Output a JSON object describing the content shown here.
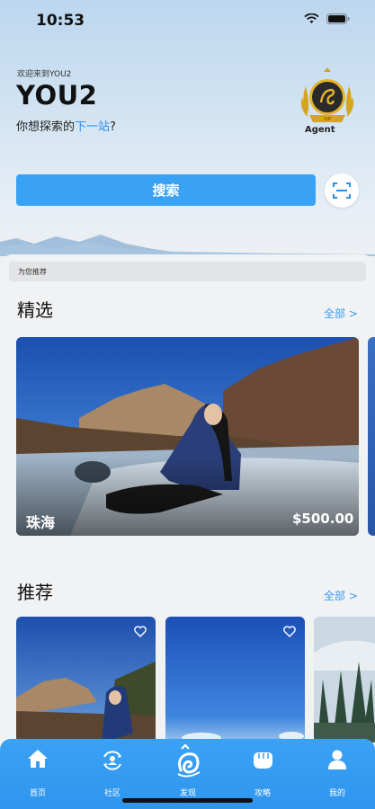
{
  "status_bar": {
    "time": "10:53"
  },
  "header": {
    "welcome": "欢迎来到YOU2",
    "brand": "YOU2",
    "question_prefix": "你想探索的",
    "question_highlight": "下一站",
    "question_suffix": "?",
    "badge_label": "Agent"
  },
  "search": {
    "button_label": "搜索"
  },
  "recommend_bar": {
    "label": "为您推荐"
  },
  "featured": {
    "title": "精选",
    "more_label": "全部 >",
    "card": {
      "city": "珠海",
      "price": "$500.00"
    }
  },
  "recommended": {
    "title": "推荐",
    "more_label": "全部 >"
  },
  "tabs": [
    {
      "label": "首页",
      "icon": "home-icon"
    },
    {
      "label": "社区",
      "icon": "community-icon"
    },
    {
      "label": "发现",
      "icon": "discover-logo-icon"
    },
    {
      "label": "攻略",
      "icon": "guide-fist-icon"
    },
    {
      "label": "我的",
      "icon": "profile-icon"
    }
  ],
  "colors": {
    "accent": "#3aa2f5",
    "link": "#2d8cf0",
    "tabbar": "#3aa2f5"
  }
}
